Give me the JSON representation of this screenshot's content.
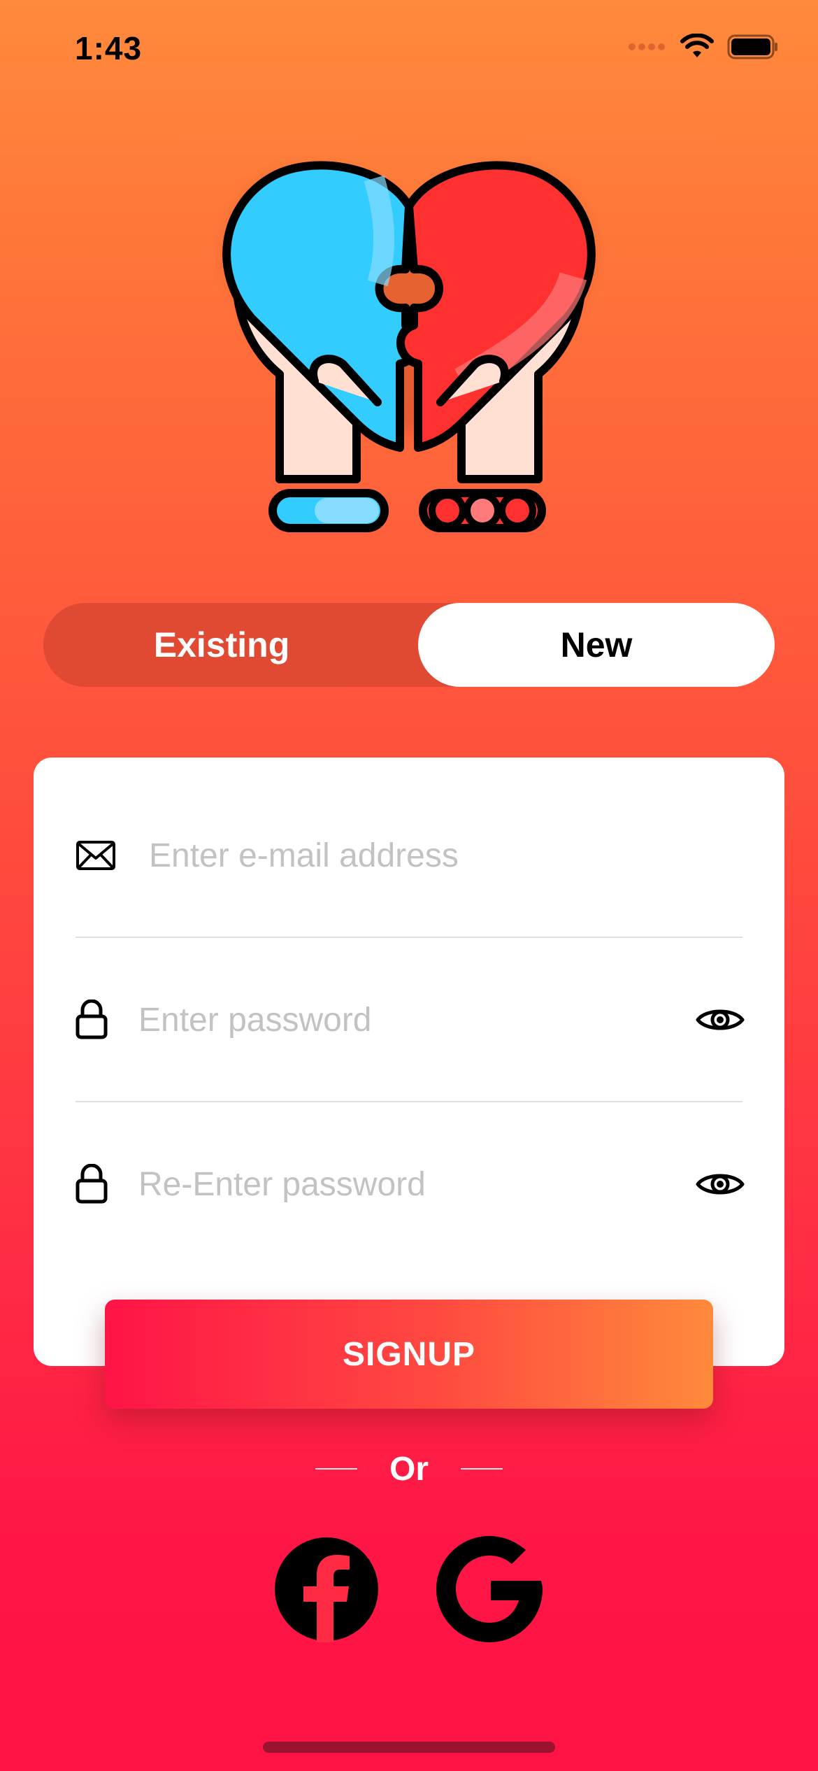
{
  "status_bar": {
    "time": "1:43"
  },
  "auth_toggle": {
    "existing_label": "Existing",
    "new_label": "New",
    "selected": "New"
  },
  "form": {
    "email_placeholder": "Enter e-mail address",
    "email_value": "",
    "password_placeholder": "Enter password",
    "password_value": "",
    "reenter_password_placeholder": "Re-Enter password",
    "reenter_password_value": ""
  },
  "signup": {
    "label": "SIGNUP"
  },
  "divider": {
    "or_label": "Or"
  },
  "icons": {
    "email": "envelope-icon",
    "password": "lock-icon",
    "show_password": "eye-icon",
    "facebook": "facebook-icon",
    "google": "google-icon"
  },
  "colors": {
    "gradient_top": "#ff8a3b",
    "gradient_bottom": "#ff1244",
    "heart_blue": "#33ccff",
    "heart_red": "#ff3030"
  }
}
